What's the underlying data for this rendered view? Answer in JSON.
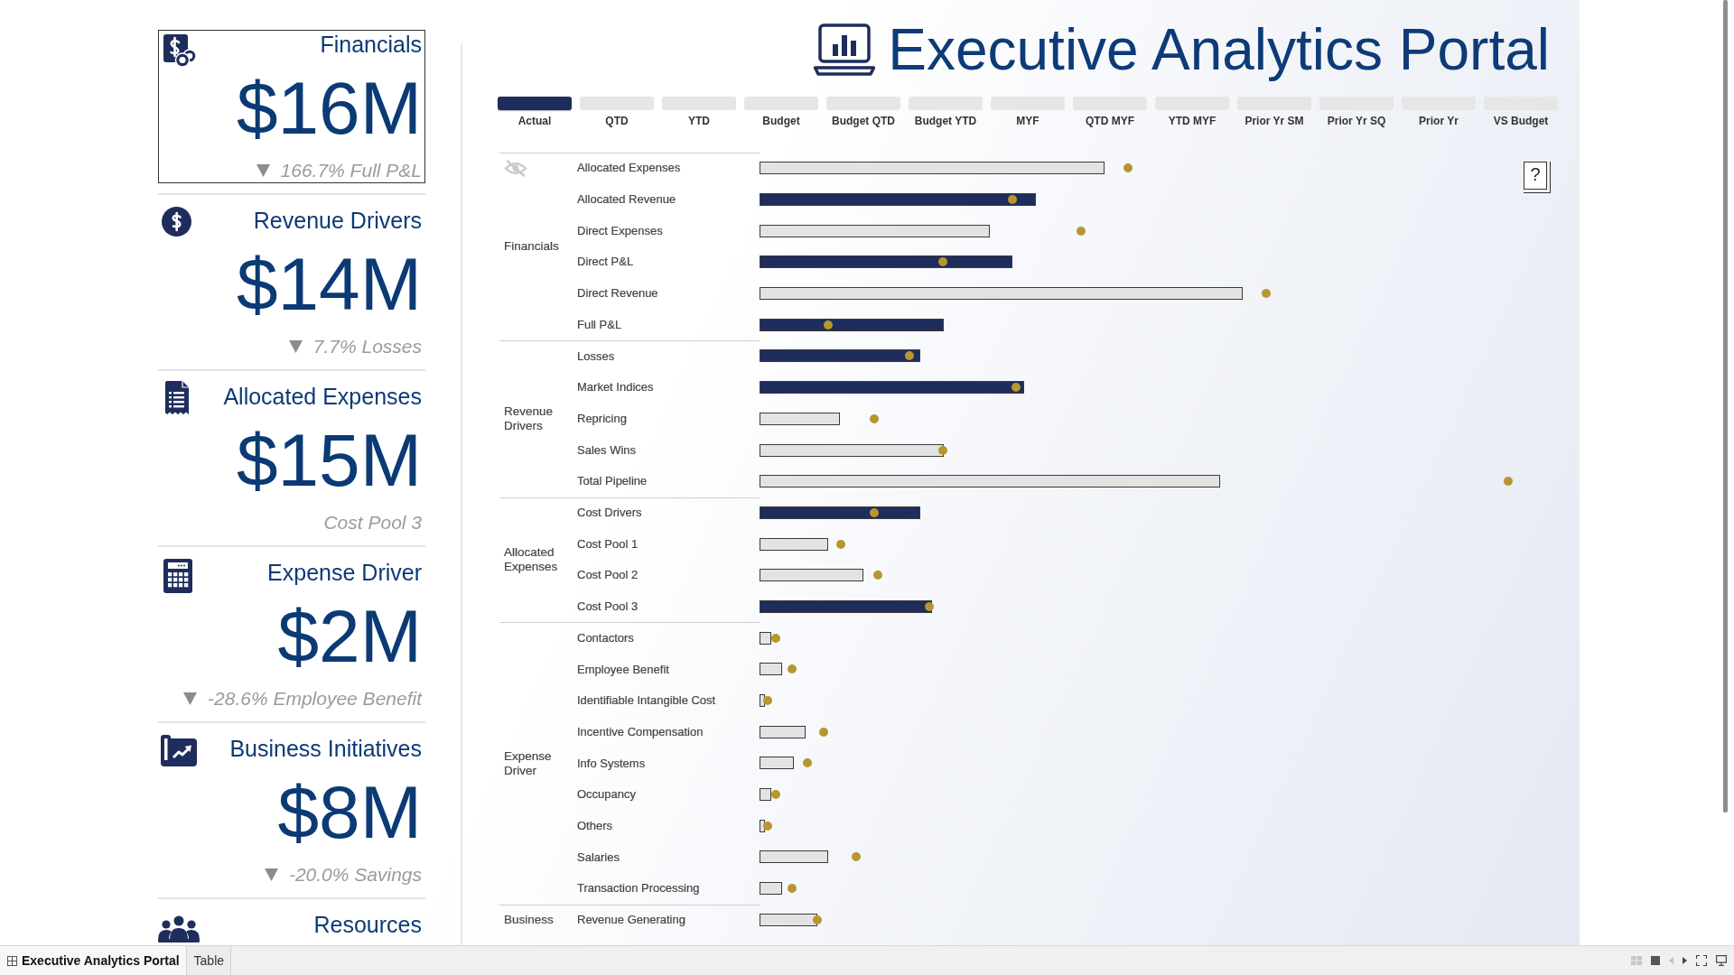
{
  "header": {
    "title": "Executive Analytics Portal"
  },
  "cards": [
    {
      "title": "Financials",
      "value": "$16M",
      "note": "166.7% Full P&L",
      "trend_down": true,
      "selected": true
    },
    {
      "title": "Revenue Drivers",
      "value": "$14M",
      "note": "7.7% Losses",
      "trend_down": true,
      "selected": false
    },
    {
      "title": "Allocated Expenses",
      "value": "$15M",
      "note": "Cost Pool 3",
      "trend_down": false,
      "selected": false
    },
    {
      "title": "Expense Driver",
      "value": "$2M",
      "note": "-28.6% Employee Benefit",
      "trend_down": true,
      "selected": false
    },
    {
      "title": "Business Initiatives",
      "value": "$8M",
      "note": "-20.0% Savings",
      "trend_down": true,
      "selected": false
    },
    {
      "title": "Resources",
      "selected": false
    }
  ],
  "period_tabs": [
    {
      "label": "Actual",
      "selected": true
    },
    {
      "label": "QTD",
      "selected": false
    },
    {
      "label": "YTD",
      "selected": false
    },
    {
      "label": "Budget",
      "selected": false
    },
    {
      "label": "Budget QTD",
      "selected": false
    },
    {
      "label": "Budget YTD",
      "selected": false
    },
    {
      "label": "MYF",
      "selected": false
    },
    {
      "label": "QTD MYF",
      "selected": false
    },
    {
      "label": "YTD MYF",
      "selected": false
    },
    {
      "label": "Prior Yr SM",
      "selected": false
    },
    {
      "label": "Prior Yr SQ",
      "selected": false
    },
    {
      "label": "Prior Yr",
      "selected": false
    },
    {
      "label": "VS Budget",
      "selected": false
    }
  ],
  "chart": {
    "help_button": {
      "label": "?"
    },
    "groups": [
      {
        "label": "Financials",
        "rows": [
          {
            "label": "Allocated Expenses",
            "level": 0.455,
            "color": "#e3e3e3",
            "target": {
              "level": 0.486
            }
          },
          {
            "label": "Allocated Revenue",
            "level": 0.364,
            "color": "#1f2d5c",
            "target": {
              "level": 0.333
            }
          },
          {
            "label": "Direct Expenses",
            "level": 0.304,
            "color": "#e3e3e3",
            "target": {
              "level": 0.424
            }
          },
          {
            "label": "Direct P&L",
            "level": 0.333,
            "color": "#1f2d5c",
            "target": {
              "level": 0.242
            }
          },
          {
            "label": "Direct Revenue",
            "level": 0.637,
            "color": "#e3e3e3",
            "target": {
              "level": 0.668
            }
          },
          {
            "label": "Full P&L",
            "level": 0.243,
            "color": "#1f2d5c",
            "target": {
              "level": 0.09
            }
          }
        ]
      },
      {
        "label": "Revenue Drivers",
        "rows": [
          {
            "label": "Losses",
            "level": 0.212,
            "color": "#1f2d5c",
            "target": {
              "level": 0.198
            }
          },
          {
            "label": "Market Indices",
            "level": 0.349,
            "color": "#1f2d5c",
            "target": {
              "level": 0.338
            }
          },
          {
            "label": "Repricing",
            "level": 0.106,
            "color": "#e3e3e3",
            "target": {
              "level": 0.151
            }
          },
          {
            "label": "Sales Wins",
            "level": 0.243,
            "color": "#e3e3e3",
            "target": {
              "level": 0.242
            }
          },
          {
            "label": "Total Pipeline",
            "level": 0.607,
            "color": "#e3e3e3",
            "target": {
              "level": 0.987
            }
          }
        ]
      },
      {
        "label": "Allocated Expenses",
        "rows": [
          {
            "label": "Cost Drivers",
            "level": 0.212,
            "color": "#1f2d5c",
            "target": {
              "level": 0.151
            }
          },
          {
            "label": "Cost Pool 1",
            "level": 0.09,
            "color": "#e3e3e3",
            "target": {
              "level": 0.107
            }
          },
          {
            "label": "Cost Pool 2",
            "level": 0.137,
            "color": "#e3e3e3",
            "target": {
              "level": 0.156
            }
          },
          {
            "label": "Cost Pool 3",
            "level": 0.227,
            "color": "#1f2d5c",
            "target": {
              "level": 0.224
            }
          }
        ]
      },
      {
        "label": "Expense Driver",
        "rows": [
          {
            "label": "Contactors",
            "level": 0.015,
            "color": "#e3e3e3",
            "target": {
              "level": 0.021
            }
          },
          {
            "label": "Employee Benefit",
            "level": 0.03,
            "color": "#e3e3e3",
            "target": {
              "level": 0.043
            }
          },
          {
            "label": "Identifiable Intangible Cost",
            "level": 0.007,
            "color": "#e3e3e3",
            "target": {
              "level": 0.011
            }
          },
          {
            "label": "Incentive Compensation",
            "level": 0.061,
            "color": "#e3e3e3",
            "target": {
              "level": 0.085
            }
          },
          {
            "label": "Info Systems",
            "level": 0.045,
            "color": "#e3e3e3",
            "target": {
              "level": 0.063
            }
          },
          {
            "label": "Occupancy",
            "level": 0.015,
            "color": "#e3e3e3",
            "target": {
              "level": 0.021
            }
          },
          {
            "label": "Others",
            "level": 0.007,
            "color": "#e3e3e3",
            "target": {
              "level": 0.011
            }
          },
          {
            "label": "Salaries",
            "level": 0.09,
            "color": "#e3e3e3",
            "target": {
              "level": 0.127
            }
          },
          {
            "label": "Transaction Processing",
            "level": 0.03,
            "color": "#e3e3e3",
            "target": {
              "level": 0.043
            }
          }
        ]
      },
      {
        "label": "Business",
        "rows": [
          {
            "label": "Revenue Generating",
            "level": 0.076,
            "color": "#e3e3e3",
            "target": {
              "level": 0.076
            }
          }
        ]
      }
    ]
  },
  "sheet_tabs": [
    {
      "label": "Executive Analytics Portal",
      "kind": "dashboard",
      "selected": true
    },
    {
      "label": "Table",
      "kind": "worksheet",
      "selected": false
    }
  ]
}
